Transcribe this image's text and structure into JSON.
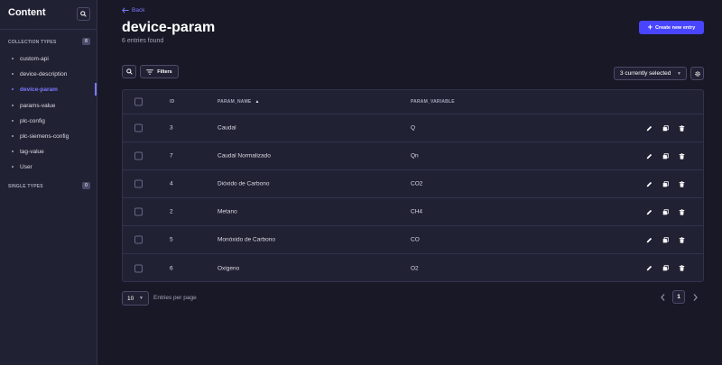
{
  "sidebar": {
    "title": "Content",
    "collection_types_label": "COLLECTION TYPES",
    "collection_types_count": "8",
    "items": [
      {
        "label": "custom-api"
      },
      {
        "label": "device-description"
      },
      {
        "label": "device-param"
      },
      {
        "label": "params-value"
      },
      {
        "label": "plc-config"
      },
      {
        "label": "plc-siemens-config"
      },
      {
        "label": "tag-value"
      },
      {
        "label": "User"
      }
    ],
    "active_item": "device-param",
    "single_types_label": "SINGLE TYPES",
    "single_types_count": "0"
  },
  "header": {
    "back_label": "Back",
    "title": "device-param",
    "subtitle": "6 entries found",
    "create_label": "Create new entry"
  },
  "toolbar": {
    "filters_label": "Filters",
    "columns_selected": "3 currently selected"
  },
  "table": {
    "headers": {
      "id": "ID",
      "name": "PARAM_NAME",
      "variable": "PARAM_VARIABLE"
    },
    "rows": [
      {
        "id": "3",
        "name": "Caudal",
        "variable": "Q"
      },
      {
        "id": "7",
        "name": "Caudal Normalizado",
        "variable": "Qn"
      },
      {
        "id": "4",
        "name": "Dióxido de Carbono",
        "variable": "CO2"
      },
      {
        "id": "2",
        "name": "Metano",
        "variable": "CH4"
      },
      {
        "id": "5",
        "name": "Monóxido de Carbono",
        "variable": "CO"
      },
      {
        "id": "6",
        "name": "Oxigeno",
        "variable": "O2"
      }
    ]
  },
  "footer": {
    "per_page_value": "10",
    "per_page_label": "Entries per page",
    "current_page": "1"
  },
  "colors": {
    "background": "#181826",
    "panel": "#212134",
    "accent": "#4945ff",
    "accent_text": "#7b79ff"
  }
}
